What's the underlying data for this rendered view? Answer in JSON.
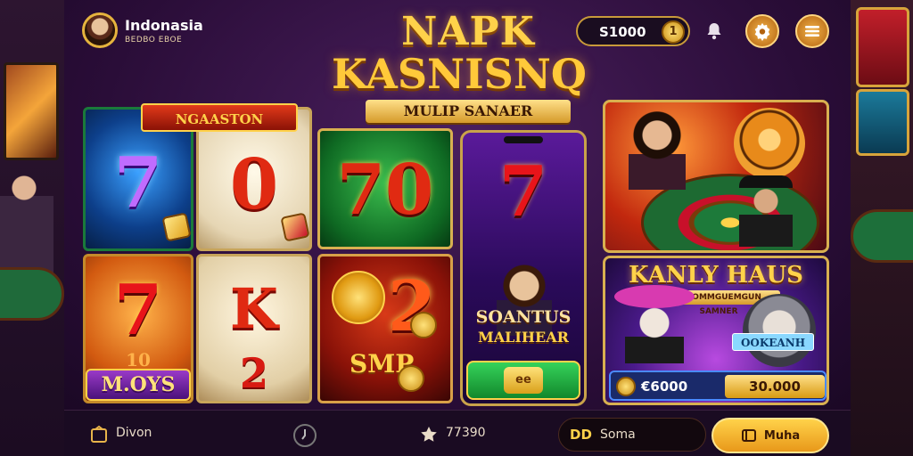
{
  "user": {
    "name": "Indonasia",
    "subline": "BEDBO EBOE"
  },
  "header": {
    "title_line1": "NAPK",
    "title_line2": "KASNISNQ",
    "ribbon": "MULIP SANAER",
    "balance": "S1000",
    "balance_coin": "1"
  },
  "icons": {
    "bell": "bell-icon",
    "settings": "gear-icon",
    "menu": "hamburger-menu-icon"
  },
  "tiles": {
    "ribbon": "NGAASTON",
    "blue_symbol": "7",
    "cream1_symbol": "0",
    "green_symbol": "70",
    "orange_symbol": "7",
    "cream2_symbol_top": "K",
    "cream2_symbol_bottom": "2",
    "red_symbol": "2",
    "woys_label": "M.OYS",
    "red_bottom_text": "SMP",
    "woys_small": "10"
  },
  "phone_card": {
    "symbol": "7",
    "name_line1": "SOANTUS",
    "name_line2": "MALIHEAR",
    "button_badge": "ee"
  },
  "promo": {
    "title": "KANLY HAUS",
    "subtitle": "IHUOMMGUEMGUN SAMNER",
    "tag": "OOKEANH",
    "amount_left": "€6000",
    "amount_right": "30.000"
  },
  "bottom_bar": {
    "left_label": "Divon",
    "center_value": "77390",
    "pill_code": "DD",
    "pill_label": "Soma",
    "deposit_label": "Muha"
  },
  "colors": {
    "accent_gold": "#ffd24a",
    "background": "#2a0d38",
    "deposit_button": "#ffd24a"
  }
}
